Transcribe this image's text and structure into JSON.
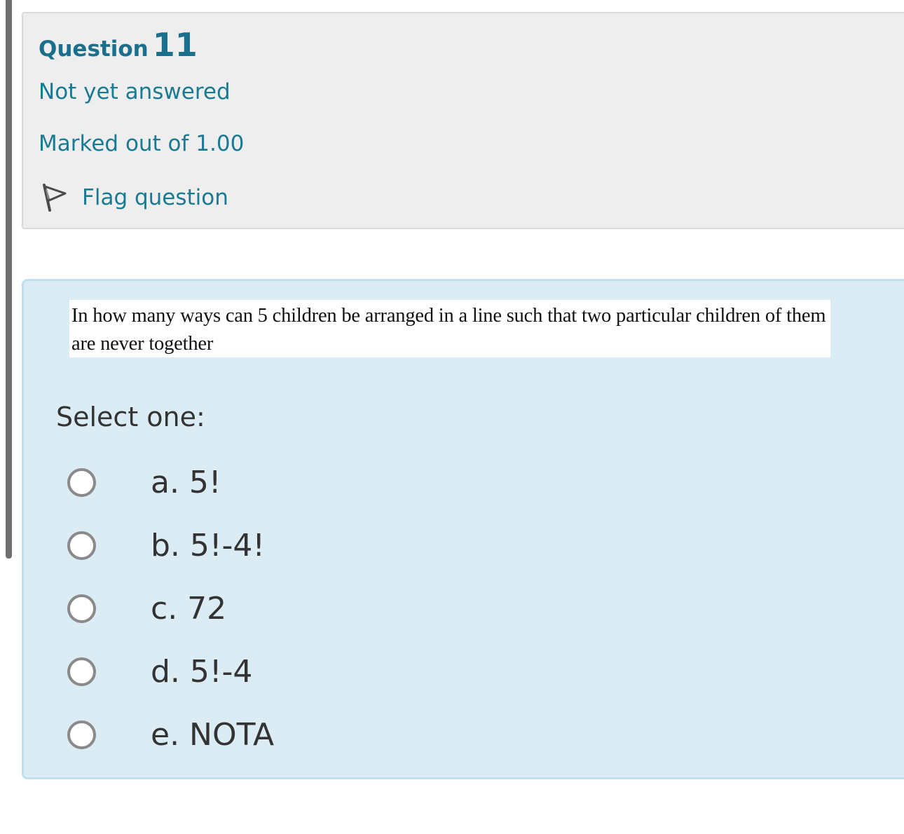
{
  "info": {
    "question_word": "Question",
    "question_number": "11",
    "state": "Not yet answered",
    "grade": "Marked out of 1.00",
    "flag_label": "Flag question"
  },
  "question": {
    "text": "In how many ways can 5 children be arranged in a line such that two particular children of them are never together",
    "prompt": "Select one:",
    "options": [
      {
        "label": "a. 5!"
      },
      {
        "label": "b. 5!-4!"
      },
      {
        "label": "c. 72"
      },
      {
        "label": "d. 5!-4"
      },
      {
        "label": "e. NOTA"
      }
    ]
  },
  "colors": {
    "link": "#1a7a93",
    "content_background": "#dbecf5",
    "info_background": "#eeeeee"
  },
  "icons": {
    "flag": "flag-icon",
    "radio": "radio-unchecked-icon"
  }
}
